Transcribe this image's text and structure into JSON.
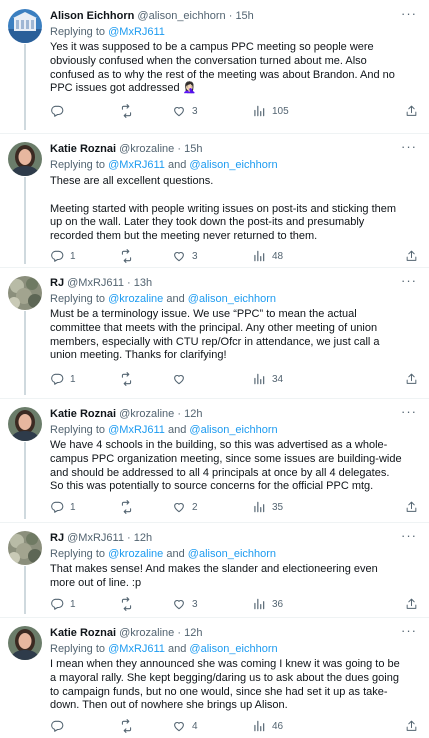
{
  "tweets": [
    {
      "name": "Alison Eichhorn",
      "handle": "@alison_eichhorn",
      "time": "15h",
      "replying_prefix": "Replying to",
      "replying_to": "@MxRJ611",
      "replying_joiner": "",
      "replying_to2": "",
      "paragraphs": [
        "Yes it was supposed to be a campus PPC meeting so people were obviously confused when the conversation turned about me. Also confused as to why the rest of the meeting was about Brandon. And no PPC issues got addressed 🤦🏻‍♀️"
      ],
      "replies": "",
      "retweets": "",
      "likes": "3",
      "views": "105"
    },
    {
      "name": "Katie Roznai",
      "handle": "@krozaline",
      "time": "15h",
      "replying_prefix": "Replying to",
      "replying_to": "@MxRJ611",
      "replying_joiner": "and",
      "replying_to2": "@alison_eichhorn",
      "paragraphs": [
        "These are all excellent questions.",
        "Meeting started with people writing issues on post-its and sticking them up on the wall.  Later they took down the post-its and presumably recorded them but the meeting never returned to them."
      ],
      "replies": "1",
      "retweets": "",
      "likes": "3",
      "views": "48"
    },
    {
      "name": "RJ",
      "handle": "@MxRJ611",
      "time": "13h",
      "replying_prefix": "Replying to",
      "replying_to": "@krozaline",
      "replying_joiner": "and",
      "replying_to2": "@alison_eichhorn",
      "paragraphs": [
        "Must be a terminology issue. We use “PPC” to mean the actual committee that meets with the principal. Any other meeting of union members, especially with CTU rep/Ofcr in attendance, we just call a union meeting. Thanks for clarifying!"
      ],
      "replies": "1",
      "retweets": "",
      "likes": "",
      "views": "34"
    },
    {
      "name": "Katie Roznai",
      "handle": "@krozaline",
      "time": "12h",
      "replying_prefix": "Replying to",
      "replying_to": "@MxRJ611",
      "replying_joiner": "and",
      "replying_to2": "@alison_eichhorn",
      "paragraphs": [
        "We have 4 schools in the building, so this was advertised as a whole-campus PPC organization meeting, since some issues are building-wide and should be addressed to all 4 principals at once by all 4 delegates. So this was potentially to source concerns for the official PPC mtg."
      ],
      "replies": "1",
      "retweets": "",
      "likes": "2",
      "views": "35"
    },
    {
      "name": "RJ",
      "handle": "@MxRJ611",
      "time": "12h",
      "replying_prefix": "Replying to",
      "replying_to": "@krozaline",
      "replying_joiner": "and",
      "replying_to2": "@alison_eichhorn",
      "paragraphs": [
        "That makes sense! And makes the slander and electioneering even more out of line. :p"
      ],
      "replies": "1",
      "retweets": "",
      "likes": "3",
      "views": "36"
    },
    {
      "name": "Katie Roznai",
      "handle": "@krozaline",
      "time": "12h",
      "replying_prefix": "Replying to",
      "replying_to": "@MxRJ611",
      "replying_joiner": "and",
      "replying_to2": "@alison_eichhorn",
      "paragraphs": [
        "I mean when they announced she was coming I knew it was going to be a mayoral rally. She kept begging/daring us to ask about the dues going to campaign funds, but no one would, since she had set it up as take-down. Then out of nowhere she brings up Alison."
      ],
      "replies": "",
      "retweets": "",
      "likes": "4",
      "views": "46"
    }
  ],
  "icons": {
    "reply": "speech-bubble",
    "retweet": "two-arrows-loop",
    "like": "heart-outline",
    "views": "bar-chart",
    "share": "upload-arrow",
    "more": "ellipsis"
  },
  "colors": {
    "link": "#1d9bf0",
    "secondary_text": "#536471",
    "separator": "#eff3f4"
  }
}
